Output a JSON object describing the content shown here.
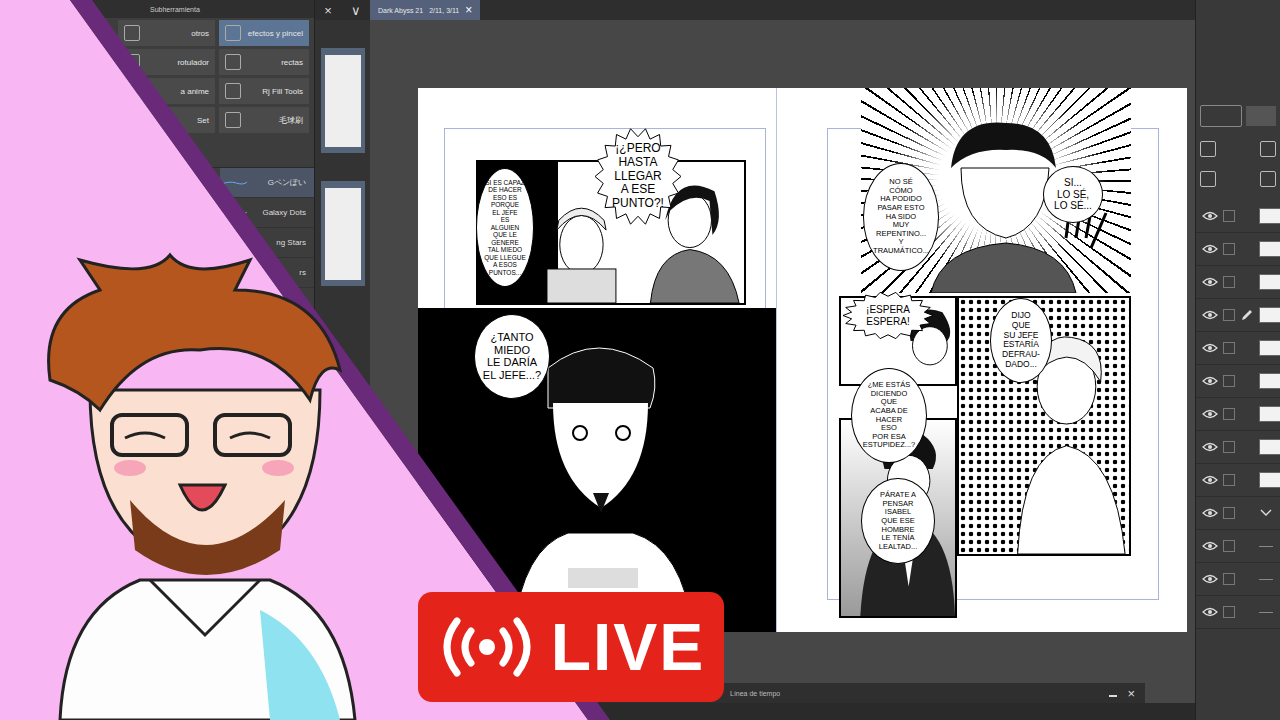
{
  "palette": {
    "tab": "Subherramienta",
    "tools": [
      {
        "label": "otros",
        "selected": false
      },
      {
        "label": "efectos y pincel",
        "selected": true
      },
      {
        "label": "rotulador",
        "selected": false
      },
      {
        "label": "rectas",
        "selected": false
      },
      {
        "label": "a anime",
        "selected": false
      },
      {
        "label": "Rj Fill Tools",
        "selected": false
      },
      {
        "label": "Set",
        "selected": false
      },
      {
        "label": "毛球刷",
        "selected": false
      }
    ],
    "brushes": [
      {
        "label": "Gペンぽい",
        "selected": true
      },
      {
        "label": "Galaxy Dots",
        "selected": false
      },
      {
        "label": "ng Stars",
        "selected": false
      },
      {
        "label": "rs",
        "selected": false
      }
    ]
  },
  "pages_panel": {
    "close": "×",
    "menu": "∨"
  },
  "document": {
    "title": "Dark Abyss 21",
    "pages": "2/11, 3/11",
    "close": "×"
  },
  "manga": {
    "left_balloons": [
      {
        "kind": "oval",
        "lines": [
          "SI ES CAPAZ",
          "DE HACER",
          "ESO ES",
          "PORQUE",
          "EL JEFE",
          "ES",
          "ALGUIEN",
          "QUE LE",
          "GENERE",
          "TAL MIEDO",
          "QUE LLEGUE",
          "A ESOS",
          "PUNTOS..."
        ]
      },
      {
        "kind": "burst",
        "lines": [
          "¡¿PERO",
          "HASTA",
          "LLEGAR",
          "A ESE",
          "PUNTO?!"
        ]
      },
      {
        "kind": "oval",
        "lines": [
          "¿TANTO",
          "MIEDO",
          "LE DARÍA",
          "EL JEFE...?"
        ]
      }
    ],
    "right_balloons": [
      {
        "kind": "oval",
        "lines": [
          "NO SÉ",
          "CÓMO",
          "HA PODIDO",
          "PASAR ESTO",
          "HA SIDO",
          "MUY",
          "REPENTINO...",
          "Y",
          "TRAUMÁTICO..."
        ]
      },
      {
        "kind": "oval",
        "lines": [
          "SI...",
          "LO SÉ,",
          "LO SÉ..."
        ]
      },
      {
        "kind": "burst",
        "lines": [
          "¡ESPERA",
          "ESPERA!"
        ]
      },
      {
        "kind": "oval",
        "lines": [
          "DIJO",
          "QUE",
          "SU JEFE",
          "ESTARÍA",
          "DEFRAU-",
          "DADO..."
        ]
      },
      {
        "kind": "oval",
        "lines": [
          "¿ME ESTÁS",
          "DICIENDO",
          "QUE",
          "ACABA DE",
          "HACER",
          "ESO",
          "POR ESA",
          "ESTUPIDEZ...?"
        ]
      },
      {
        "kind": "oval",
        "lines": [
          "PÁRATE A",
          "PENSAR",
          "ISABEL",
          "QUE ESE",
          "HOMBRE",
          "LE TENÍA",
          "LEALTAD..."
        ]
      }
    ]
  },
  "layers": [
    {
      "kind": "layer",
      "visible": true,
      "editing": false
    },
    {
      "kind": "layer",
      "visible": true,
      "editing": false
    },
    {
      "kind": "layer",
      "visible": true,
      "editing": false
    },
    {
      "kind": "layer",
      "visible": true,
      "editing": true
    },
    {
      "kind": "layer",
      "visible": true,
      "editing": false
    },
    {
      "kind": "layer",
      "visible": true,
      "editing": false
    },
    {
      "kind": "layer",
      "visible": true,
      "editing": false
    },
    {
      "kind": "layer",
      "visible": true,
      "editing": false
    },
    {
      "kind": "layer",
      "visible": true,
      "editing": false
    },
    {
      "kind": "folder",
      "visible": true,
      "editing": false
    },
    {
      "kind": "child",
      "visible": true,
      "editing": false
    },
    {
      "kind": "child",
      "visible": true,
      "editing": false
    },
    {
      "kind": "child",
      "visible": true,
      "editing": false
    }
  ],
  "timeline": {
    "title": "Línea de tiempo",
    "close": "×"
  },
  "live_badge": {
    "label": "LIVE"
  }
}
